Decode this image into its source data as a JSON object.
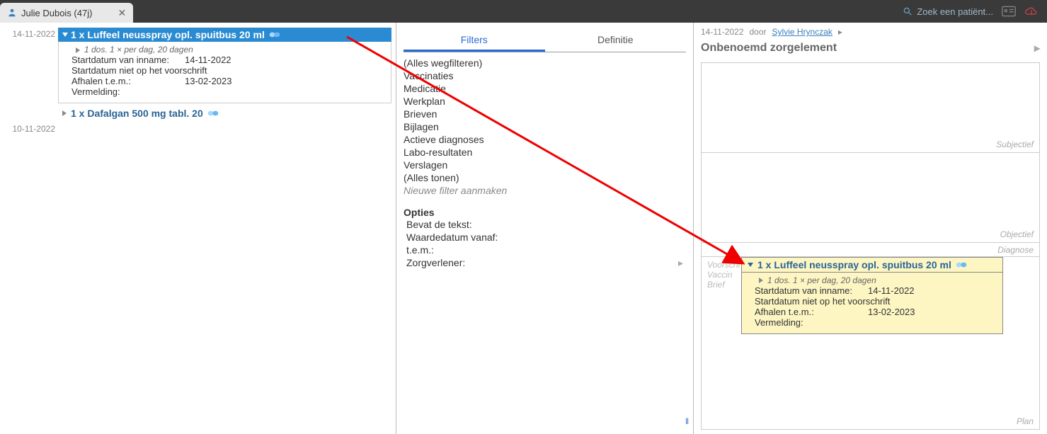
{
  "topbar": {
    "patient_tab": "Julie Dubois (47j)",
    "search_placeholder": "Zoek een patiënt..."
  },
  "left": {
    "dates": [
      "14-11-2022",
      "10-11-2022"
    ],
    "presc1": {
      "title": "1 x Luffeel neusspray opl. spuitbus 20 ml",
      "posology": "1 dos.   1 × per dag,   20 dagen",
      "start_label": "Startdatum van inname:",
      "start_val": "14-11-2022",
      "not_on_rx": "Startdatum niet op het voorschrift",
      "afhalen_label": "Afhalen t.e.m.:",
      "afhalen_val": "13-02-2023",
      "vermelding": "Vermelding:"
    },
    "presc2": {
      "title": "1 x Dafalgan 500 mg tabl. 20"
    }
  },
  "mid": {
    "tab_filters": "Filters",
    "tab_definitie": "Definitie",
    "filters": [
      "(Alles wegfilteren)",
      "Vaccinaties",
      "Medicatie",
      "Werkplan",
      "Brieven",
      "Bijlagen",
      "Actieve diagnoses",
      "Labo-resultaten",
      "Verslagen",
      "(Alles tonen)"
    ],
    "new_filter": "Nieuwe filter aanmaken",
    "opties_hdr": "Opties",
    "opt_text": "Bevat de tekst:",
    "opt_from": "Waardedatum vanaf:",
    "opt_to": "t.e.m.:",
    "opt_provider": "Zorgverlener:"
  },
  "right": {
    "meta_date": "14-11-2022",
    "meta_by": "door",
    "meta_author": "Sylvie Hrynczak",
    "care_title": "Onbenoemd zorgelement",
    "ghosts": {
      "voorschrift": "Voorschrift",
      "vaccin": "Vaccin",
      "brief": "Brief"
    },
    "soap": {
      "subj": "Subjectief",
      "obj": "Objectief",
      "diag": "Diagnose",
      "plan": "Plan"
    }
  }
}
